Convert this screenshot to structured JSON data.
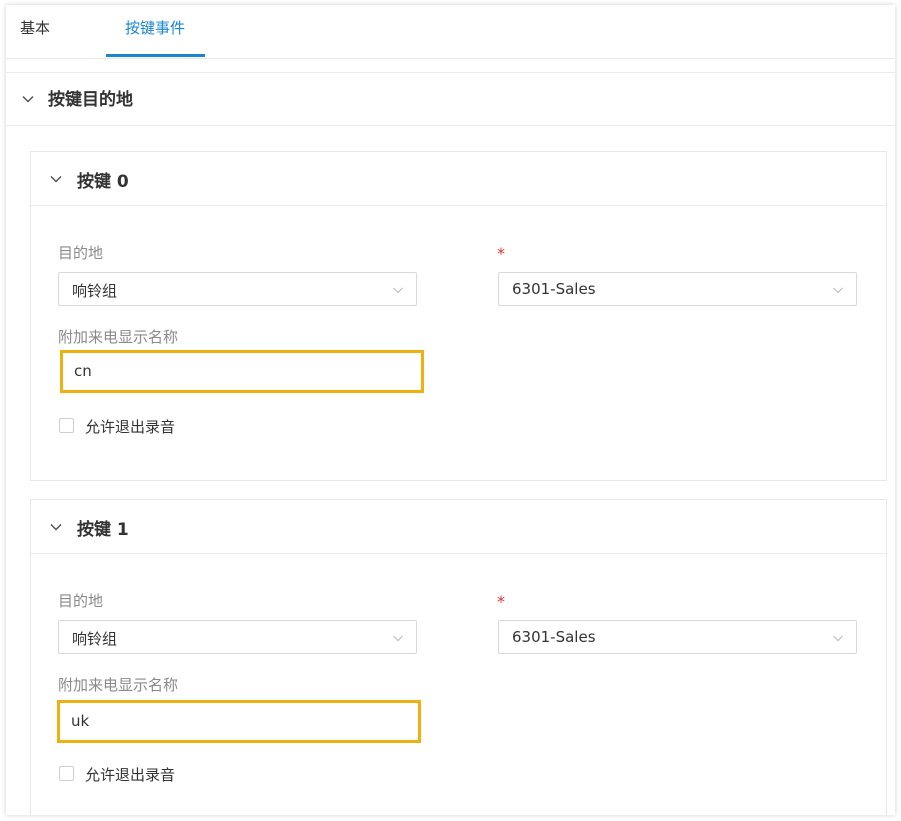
{
  "tabs": {
    "basic": "基本",
    "key_events": "按键事件"
  },
  "section": {
    "title": "按键目的地"
  },
  "keys": [
    {
      "title": "按键 0",
      "destination_label": "目的地",
      "destination_type": "响铃组",
      "required_mark": "*",
      "destination_value": "6301-Sales",
      "caller_name_label": "附加来电显示名称",
      "caller_name_value": "cn",
      "allow_exit_label": "允许退出录音",
      "allow_exit_checked": false
    },
    {
      "title": "按键 1",
      "destination_label": "目的地",
      "destination_type": "响铃组",
      "required_mark": "*",
      "destination_value": "6301-Sales",
      "caller_name_label": "附加来电显示名称",
      "caller_name_value": "uk",
      "allow_exit_label": "允许退出录音",
      "allow_exit_checked": false
    }
  ],
  "colors": {
    "accent": "#1a86d0",
    "highlight": "#f0b011",
    "required": "#e0332b"
  },
  "icons": {
    "collapse": "chevron-down-icon",
    "dropdown": "chevron-down-icon"
  }
}
